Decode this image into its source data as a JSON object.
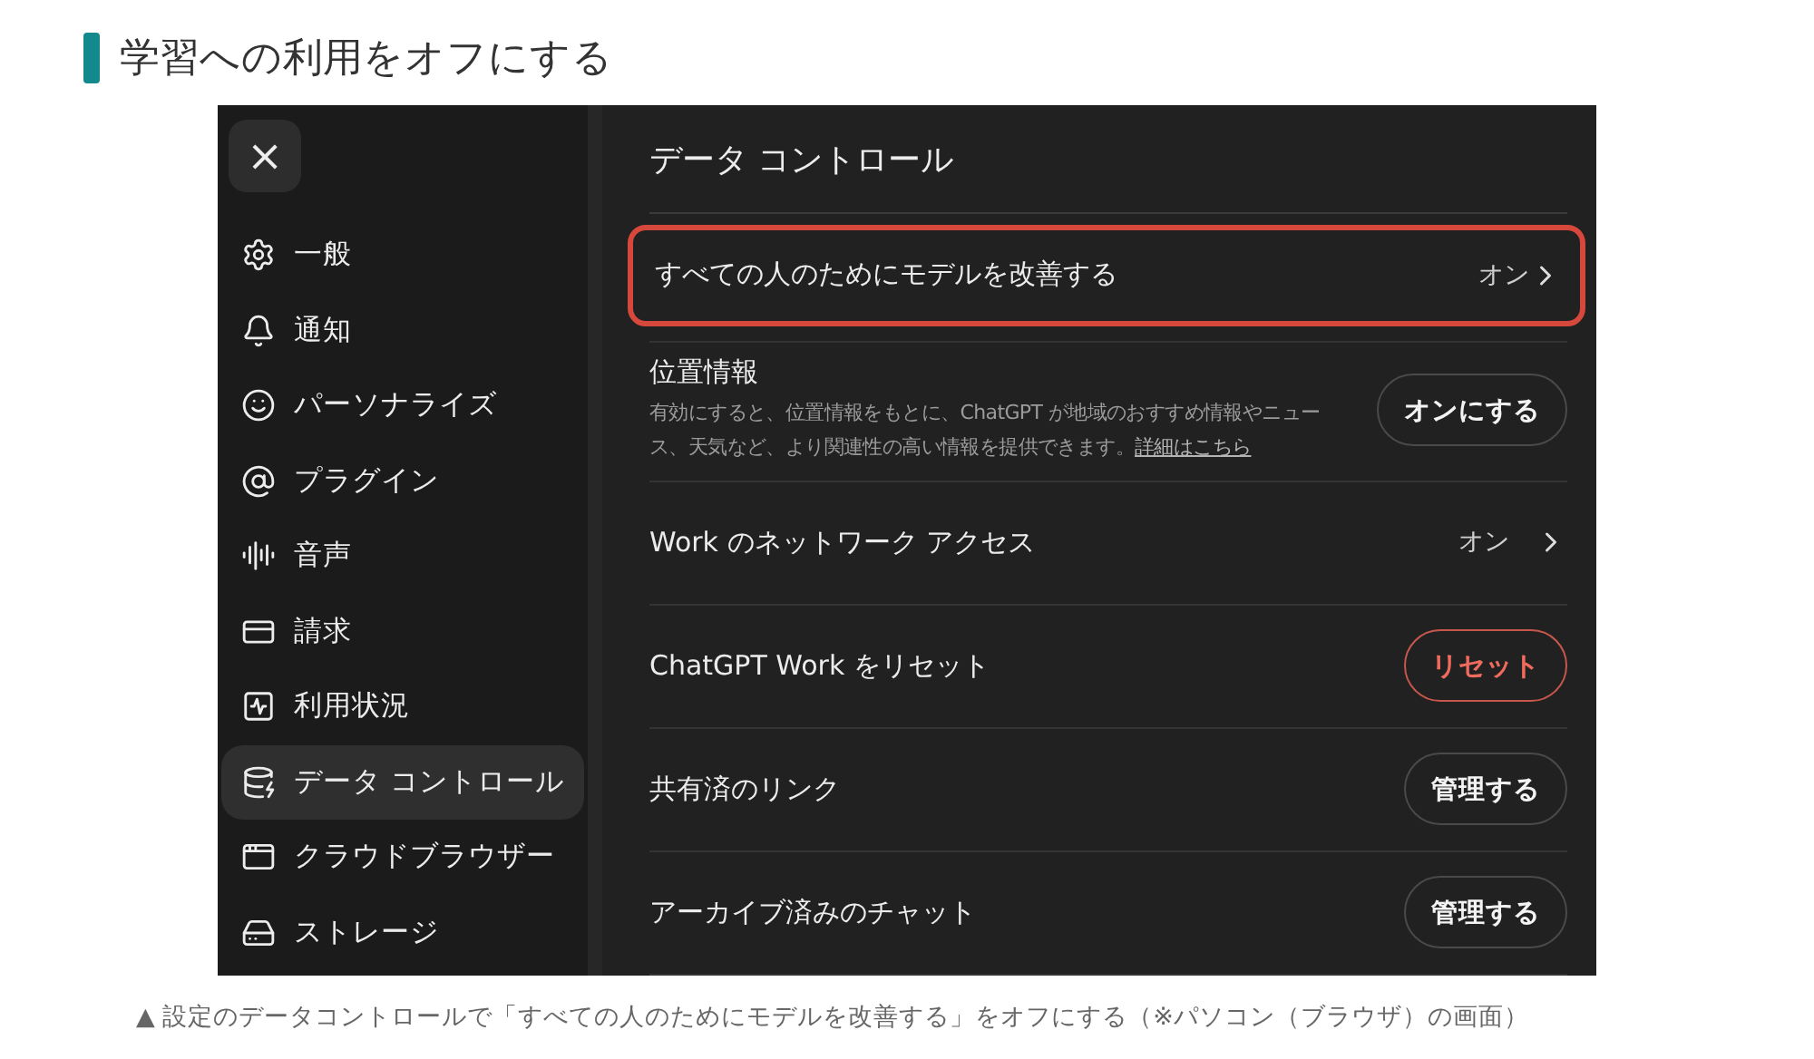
{
  "heading": "学習への利用をオフにする",
  "settings": {
    "close": "×",
    "sidebar": [
      {
        "label": "一般",
        "selected": false
      },
      {
        "label": "通知",
        "selected": false
      },
      {
        "label": "パーソナライズ",
        "selected": false
      },
      {
        "label": "プラグイン",
        "selected": false
      },
      {
        "label": "音声",
        "selected": false
      },
      {
        "label": "請求",
        "selected": false
      },
      {
        "label": "利用状況",
        "selected": false
      },
      {
        "label": "データ コントロール",
        "selected": true
      },
      {
        "label": "クラウドブラウザー",
        "selected": false
      },
      {
        "label": "ストレージ",
        "selected": false
      }
    ],
    "title": "データ コントロール",
    "rows": [
      {
        "kind": "value",
        "label": "すべての人のためにモデルを改善する",
        "value": "オン",
        "highlighted": true
      },
      {
        "kind": "button",
        "label": "位置情報",
        "description": "有効にすると、位置情報をもとに、ChatGPT が地域のおすすめ情報やニュース、天気など、より関連性の高い情報を提供できます。",
        "link": "詳細はこちら",
        "button": "オンにする",
        "danger": false,
        "highlighted": false
      },
      {
        "kind": "value",
        "label": "Work のネットワーク アクセス",
        "value": "オン",
        "highlighted": false
      },
      {
        "kind": "button",
        "label": "ChatGPT Work をリセット",
        "button": "リセット",
        "danger": true,
        "highlighted": false
      },
      {
        "kind": "button",
        "label": "共有済のリンク",
        "button": "管理する",
        "danger": false,
        "highlighted": false
      },
      {
        "kind": "button",
        "label": "アーカイブ済みのチャット",
        "button": "管理する",
        "danger": false,
        "highlighted": false
      }
    ]
  },
  "caption": "▲ 設定のデータコントロールで「すべての人のためにモデルを改善する」をオフにする（※パソコン（ブラウザ）の画面）"
}
